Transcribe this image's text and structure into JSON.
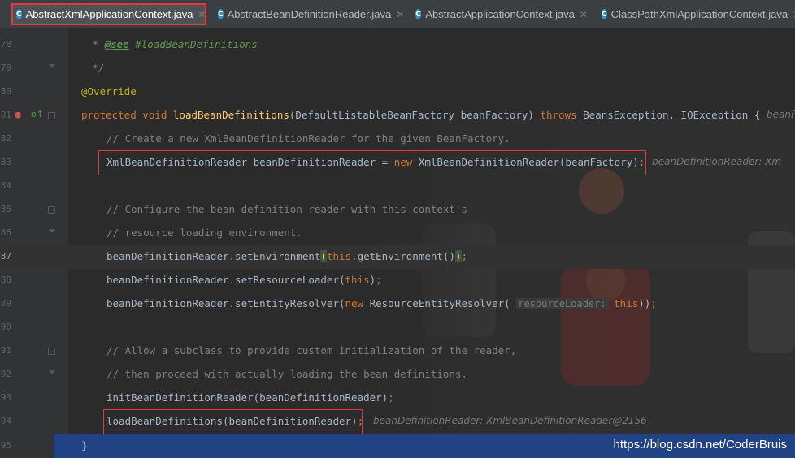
{
  "tabs": [
    {
      "label": "AbstractXmlApplicationContext.java",
      "icon": "class-icon",
      "active": true
    },
    {
      "label": "AbstractBeanDefinitionReader.java",
      "icon": "class-icon",
      "active": false
    },
    {
      "label": "AbstractApplicationContext.java",
      "icon": "class-icon",
      "active": false
    },
    {
      "label": "ClassPathXmlApplicationContext.java",
      "icon": "class-icon",
      "active": false
    }
  ],
  "lines": [
    {
      "num": "78",
      "text": " * @see #loadBeanDefinitions"
    },
    {
      "num": "79",
      "text": " */"
    },
    {
      "num": "80",
      "text": "@Override"
    },
    {
      "num": "81",
      "text": "protected void loadBeanDefinitions(DefaultListableBeanFactory beanFactory) throws BeansException, IOException {",
      "hint": "beanF"
    },
    {
      "num": "82",
      "text": "// Create a new XmlBeanDefinitionReader for the given BeanFactory."
    },
    {
      "num": "83",
      "text": "XmlBeanDefinitionReader beanDefinitionReader = new XmlBeanDefinitionReader(beanFactory);",
      "hint": "beanDefinitionReader: Xm"
    },
    {
      "num": "84",
      "text": ""
    },
    {
      "num": "85",
      "text": "// Configure the bean definition reader with this context's"
    },
    {
      "num": "86",
      "text": "// resource loading environment."
    },
    {
      "num": "87",
      "text": "beanDefinitionReader.setEnvironment(this.getEnvironment());"
    },
    {
      "num": "88",
      "text": "beanDefinitionReader.setResourceLoader(this);"
    },
    {
      "num": "89",
      "text": "beanDefinitionReader.setEntityResolver(new ResourceEntityResolver( resourceLoader: this));"
    },
    {
      "num": "90",
      "text": ""
    },
    {
      "num": "91",
      "text": "// Allow a subclass to provide custom initialization of the reader,"
    },
    {
      "num": "92",
      "text": "// then proceed with actually loading the bean definitions."
    },
    {
      "num": "93",
      "text": "initBeanDefinitionReader(beanDefinitionReader);"
    },
    {
      "num": "94",
      "text": "loadBeanDefinitions(beanDefinitionReader);",
      "hint": "beanDefinitionReader: XmlBeanDefinitionReader@2156"
    },
    {
      "num": "95",
      "text": "}"
    }
  ],
  "watermark": "https://blog.csdn.net/CoderBruis",
  "colors": {
    "keyword": "#cc7832",
    "method": "#ffc66d",
    "comment": "#808080",
    "annotation": "#bbb529",
    "highlight_box": "#e03a3a",
    "selection": "#214283"
  }
}
